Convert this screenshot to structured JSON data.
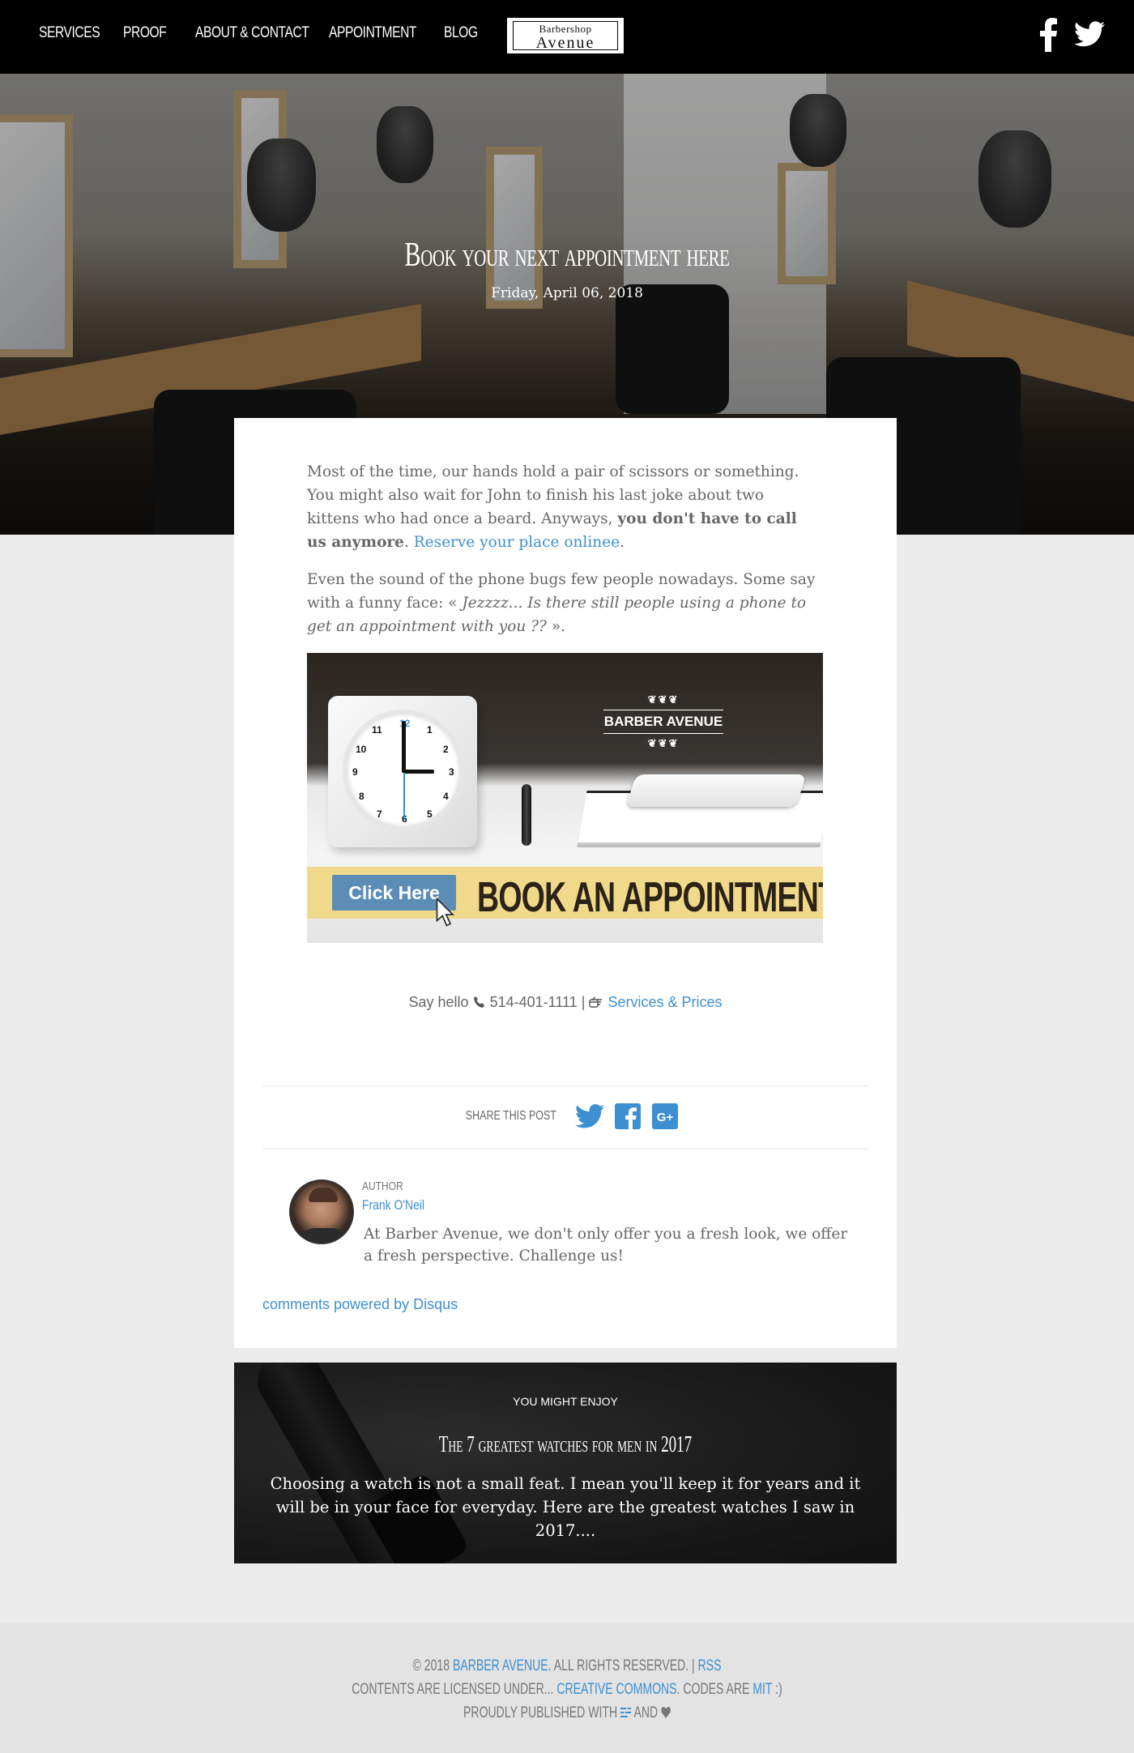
{
  "nav": {
    "items": [
      "Services",
      "Proof",
      "About & Contact",
      "Appointment",
      "Blog"
    ],
    "logo_top": "Barbershop",
    "logo_bottom": "Avenue"
  },
  "social": {
    "facebook": "facebook-icon",
    "twitter": "twitter-icon"
  },
  "hero": {
    "title": "Book your next appointment here",
    "date": "Friday, April 06, 2018"
  },
  "article": {
    "p1_text": "Most of the time, our hands hold a pair of scissors or something. You might also wait for John to finish his last joke about two kittens who had once a beard. Anyways, ",
    "p1_bold": "you don't have to call us anymore",
    "p1_after": ".",
    "p1_link": "Reserve your place onlinee",
    "p1_end": ".",
    "p2_text": "Even the sound of the phone bugs few people nowadays. Some say with a funny face: « ",
    "p2_italic": "Jezzzz... Is there still people using a phone to get an appointment with you ??",
    "p2_end": " ».",
    "banner": {
      "brand": "BARBER AVENUE",
      "button": "Click Here",
      "headline": "BOOK AN APPOINTMENT"
    },
    "contact": {
      "say_hello": "Say hello",
      "phone": "514-401-1111",
      "separator": "|",
      "services_link": "Services & Prices"
    }
  },
  "share": {
    "label": "Share this post",
    "icons": [
      "twitter-icon",
      "facebook-icon",
      "google-plus-icon"
    ]
  },
  "author": {
    "label": "AUTHOR",
    "name": "Frank O'Neil",
    "bio": "At Barber Avenue, we don't only offer you a fresh look, we offer a fresh perspective. Challenge us!"
  },
  "disqus": "comments powered by Disqus",
  "related": {
    "label": "YOU MIGHT ENJOY",
    "title": "The 7 greatest watches for men in 2017",
    "text": "Choosing a watch is not a small feat. I mean you'll keep it for years and it will be in your face for everyday. Here are the greatest watches I saw in 2017...."
  },
  "footer": {
    "copyright": "© 2018",
    "brand_link": "Barber Avenue",
    "rights": ". All rights reserved. |",
    "rss": "RSS",
    "license_pre": "Contents are licensed under...",
    "license_link": "Creative Commons",
    "codes_pre": ". Codes are",
    "mit": "MIT",
    "codes_end": ":)",
    "published_pre": "Proudly published with",
    "and": "and"
  },
  "colors": {
    "accent": "#3d8fd1",
    "nav_bg": "#000000",
    "page_bg": "#ececec",
    "banner_strip": "#f0d98a"
  }
}
